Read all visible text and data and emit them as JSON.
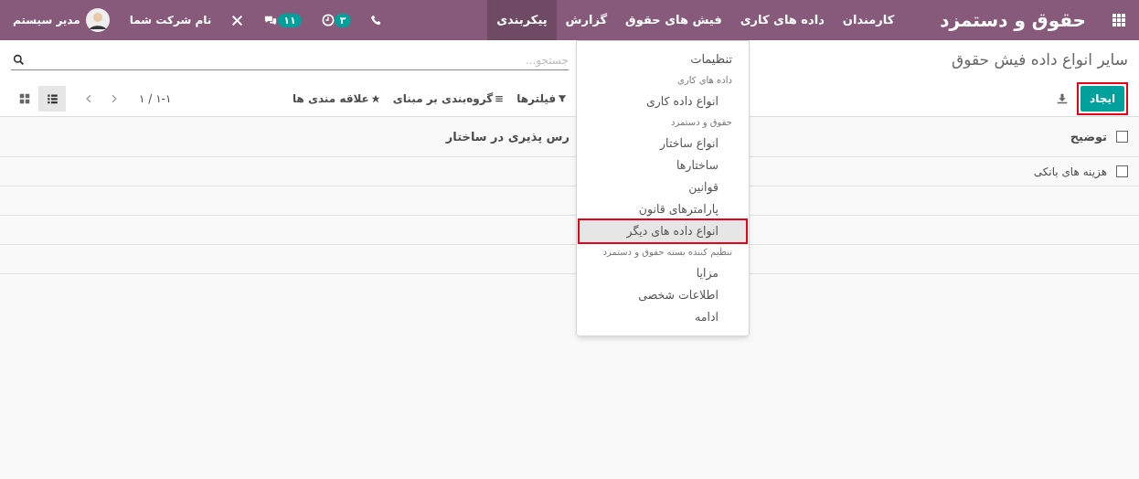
{
  "navbar": {
    "brand": "حقوق و دستمزد",
    "menu": [
      {
        "label": "کارمندان",
        "selected": false
      },
      {
        "label": "داده های کاری",
        "selected": false
      },
      {
        "label": "فیش های حقوق",
        "selected": false
      },
      {
        "label": "گزارش",
        "selected": false
      },
      {
        "label": "پیکربندی",
        "selected": true
      }
    ],
    "activity_badge": "۳",
    "messages_badge": "۱۱",
    "company": "نام شرکت شما",
    "user": "مدیر سیستم"
  },
  "dropdown": [
    {
      "kind": "title",
      "label": "تنظیمات"
    },
    {
      "kind": "header",
      "label": "داده های کاری"
    },
    {
      "kind": "item",
      "label": "انواع داده کاری",
      "selected": false,
      "highlighted": false
    },
    {
      "kind": "header",
      "label": "حقوق و دستمزد"
    },
    {
      "kind": "item",
      "label": "انواع ساختار",
      "selected": false,
      "highlighted": false
    },
    {
      "kind": "item",
      "label": "ساختارها",
      "selected": false,
      "highlighted": false
    },
    {
      "kind": "item",
      "label": "قوانین",
      "selected": false,
      "highlighted": false
    },
    {
      "kind": "item",
      "label": "پارامترهای قانون",
      "selected": false,
      "highlighted": false
    },
    {
      "kind": "item",
      "label": "انواع داده های دیگر",
      "selected": true,
      "highlighted": true
    },
    {
      "kind": "header",
      "label": "تنظیم کننده بسته حقوق و دستمزد"
    },
    {
      "kind": "item",
      "label": "مزایا",
      "selected": false,
      "highlighted": false
    },
    {
      "kind": "item",
      "label": "اطلاعات شخصی",
      "selected": false,
      "highlighted": false
    },
    {
      "kind": "item",
      "label": "ادامه",
      "selected": false,
      "highlighted": false
    }
  ],
  "breadcrumb": "سایر انواع داده فیش حقوق",
  "search": {
    "placeholder": "جستجو..."
  },
  "create_button": {
    "label": "ایجاد",
    "highlighted": true
  },
  "filters": [
    "فیلترها",
    "گروه‌بندی بر مبنای",
    "علاقه مندی ها"
  ],
  "pager": "۱-۱ / ۱",
  "views": [
    {
      "kind": "list",
      "selected": true
    },
    {
      "kind": "kanban",
      "selected": false
    }
  ],
  "table": {
    "columns": [
      "توضیح",
      "رس پذیری در ساختار"
    ],
    "select_all_checked": false,
    "rows": [
      {
        "checked": false,
        "cells": [
          "هزینه های بانکی"
        ]
      }
    ]
  }
}
